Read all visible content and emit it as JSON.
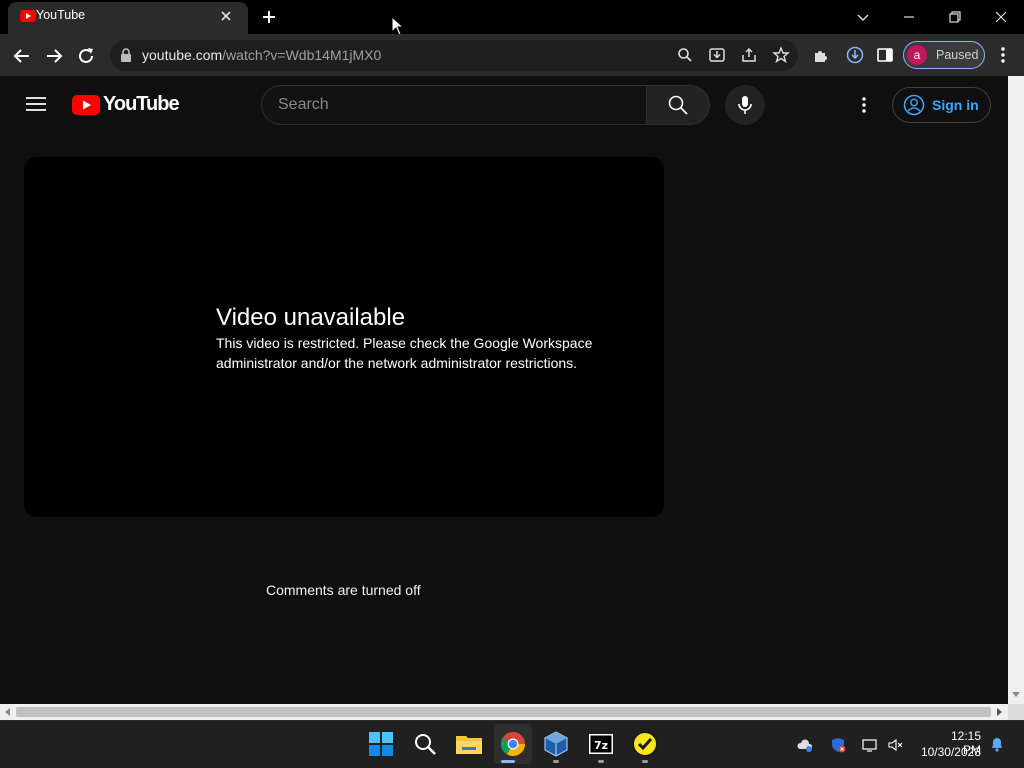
{
  "browser": {
    "tab_title": "YouTube",
    "url_host": "youtube.com",
    "url_path": "/watch?v=Wdb14M1jMX0",
    "profile_initial": "a",
    "profile_status": "Paused"
  },
  "youtube": {
    "logo_text": "YouTube",
    "search_placeholder": "Search",
    "sign_in_label": "Sign in",
    "error_title": "Video unavailable",
    "error_message": "This video is restricted. Please check the Google Workspace administrator and/or the network administrator restrictions.",
    "comments_status": "Comments are turned off"
  },
  "taskbar": {
    "time": "12:15 PM",
    "date": "10/30/2023",
    "apps": [
      "start-icon",
      "search-icon",
      "file-explorer-icon",
      "chrome-icon",
      "virtualbox-icon",
      "7zip-icon",
      "norton-icon"
    ]
  },
  "colors": {
    "yt_red": "#ff0000",
    "link_blue": "#3ea6ff",
    "profile_avatar": "#c2185b"
  }
}
